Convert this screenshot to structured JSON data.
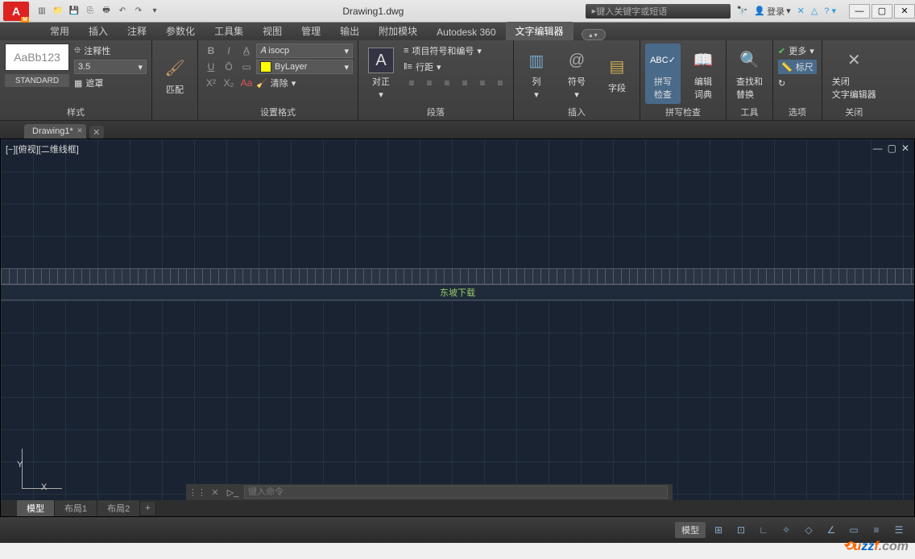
{
  "title": {
    "filename": "Drawing1.dwg"
  },
  "search": {
    "placeholder": "键入关键字或短语"
  },
  "login": {
    "label": "登录"
  },
  "ribbon": {
    "tabs": [
      "常用",
      "插入",
      "注释",
      "参数化",
      "工具集",
      "视图",
      "管理",
      "输出",
      "附加模块",
      "Autodesk 360",
      "文字编辑器"
    ],
    "active": 10
  },
  "style": {
    "preview": "AaBb123",
    "name": "STANDARD",
    "annotative": "注释性",
    "height": "3.5",
    "mask": "遮罩",
    "panel": "样式",
    "match": "匹配"
  },
  "format": {
    "font": "isocp",
    "layer": "ByLayer",
    "clear": "清除",
    "panel": "设置格式"
  },
  "justify": {
    "label": "对正",
    "panel": "段落",
    "bullets": "项目符号和编号",
    "spacing": "行距"
  },
  "insert": {
    "column": "列",
    "symbol": "符号",
    "field": "字段",
    "panel": "插入"
  },
  "spell": {
    "check": "拼写\n检查",
    "dict": "编辑\n词典",
    "panel": "拼写检查"
  },
  "tools": {
    "find": "查找和\n替换",
    "panel": "工具"
  },
  "options": {
    "more": "更多",
    "ruler": "标尺",
    "panel": "选项"
  },
  "close": {
    "label": "关闭\n文字编辑器",
    "panel": "关闭"
  },
  "filetab": {
    "name": "Drawing1*"
  },
  "viewport": {
    "label": "[−][俯视][二维线框]",
    "text": "东坡下载"
  },
  "ucs": {
    "x": "X",
    "y": "Y"
  },
  "cmd": {
    "placeholder": "键入命令"
  },
  "layouts": [
    "模型",
    "布局1",
    "布局2"
  ],
  "status": {
    "model": "模型"
  },
  "watermark": {
    "u": "u",
    "zz": "zz",
    "f": "f",
    "com": ".com"
  }
}
